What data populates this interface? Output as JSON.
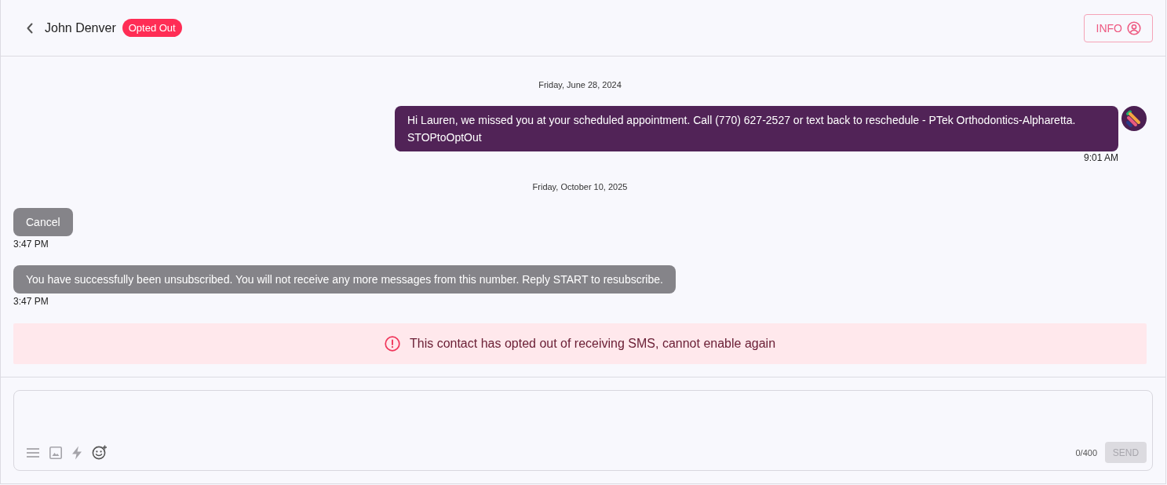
{
  "header": {
    "contact_name": "John Denver",
    "status_badge": "Opted Out",
    "info_button": "INFO"
  },
  "messages": [
    {
      "kind": "date",
      "text": "Friday, June 28, 2024"
    },
    {
      "kind": "outgoing",
      "text": "Hi Lauren, we missed you at your scheduled appointment. Call (770) 627-2527 or text back to reschedule - PTek Orthodontics-Alpharetta. STOPtoOptOut",
      "time": "9:01 AM"
    },
    {
      "kind": "date",
      "text": "Friday, October 10, 2025"
    },
    {
      "kind": "incoming",
      "text": "Cancel",
      "time": "3:47 PM"
    },
    {
      "kind": "incoming",
      "text": "You have successfully been unsubscribed. You will not receive any more messages from this number. Reply START to resubscribe.",
      "time": "3:47 PM"
    }
  ],
  "alert": {
    "text": "This contact has opted out of receiving SMS, cannot enable again"
  },
  "composer": {
    "counter": "0/400",
    "send_button": {
      "label": "SEND",
      "disabled": true
    }
  }
}
